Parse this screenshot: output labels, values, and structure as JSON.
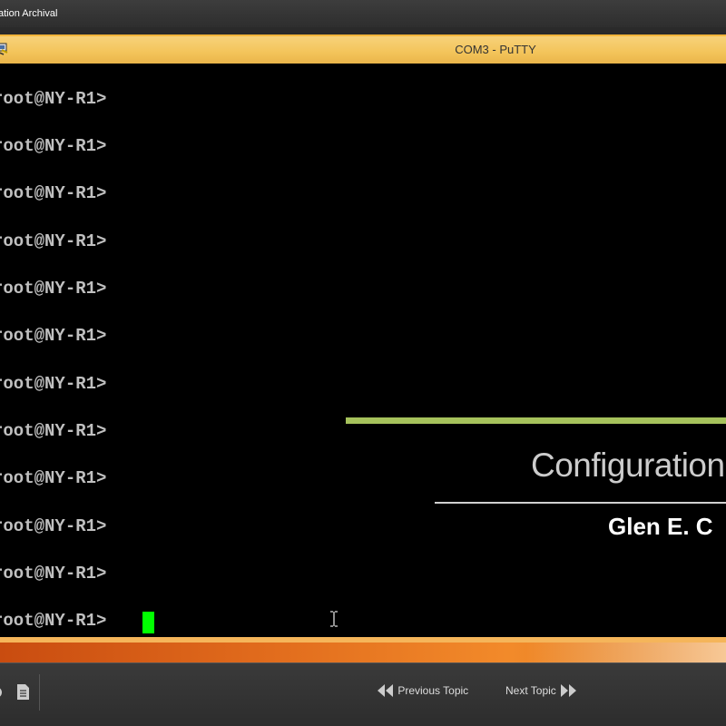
{
  "window": {
    "title": "ation Archival"
  },
  "putty": {
    "caption": "COM3 - PuTTY",
    "icon": "putty-computer-icon"
  },
  "terminal": {
    "lines": [
      "root@NY-R1>",
      "root@NY-R1>",
      "root@NY-R1>",
      "root@NY-R1>",
      "root@NY-R1>",
      "root@NY-R1>",
      "root@NY-R1>",
      "root@NY-R1>",
      "root@NY-R1>",
      "root@NY-R1>",
      "root@NY-R1>",
      "root@NY-R1>"
    ],
    "cursor_color": "#00ff00"
  },
  "slide": {
    "title": "Configuration",
    "author": "Glen E. C",
    "accent_color": "#a6c25c"
  },
  "bottom_bar": {
    "previous_label": "Previous Topic",
    "next_label": "Next Topic",
    "icons": [
      "partial-icon",
      "document-icon",
      "rewind-icon",
      "fast-forward-icon"
    ]
  },
  "colors": {
    "putty_title_bg": "#f3c45a",
    "terminal_bg": "#000000",
    "terminal_text": "#c0c0c0",
    "taskbar": "#e06a1c"
  }
}
